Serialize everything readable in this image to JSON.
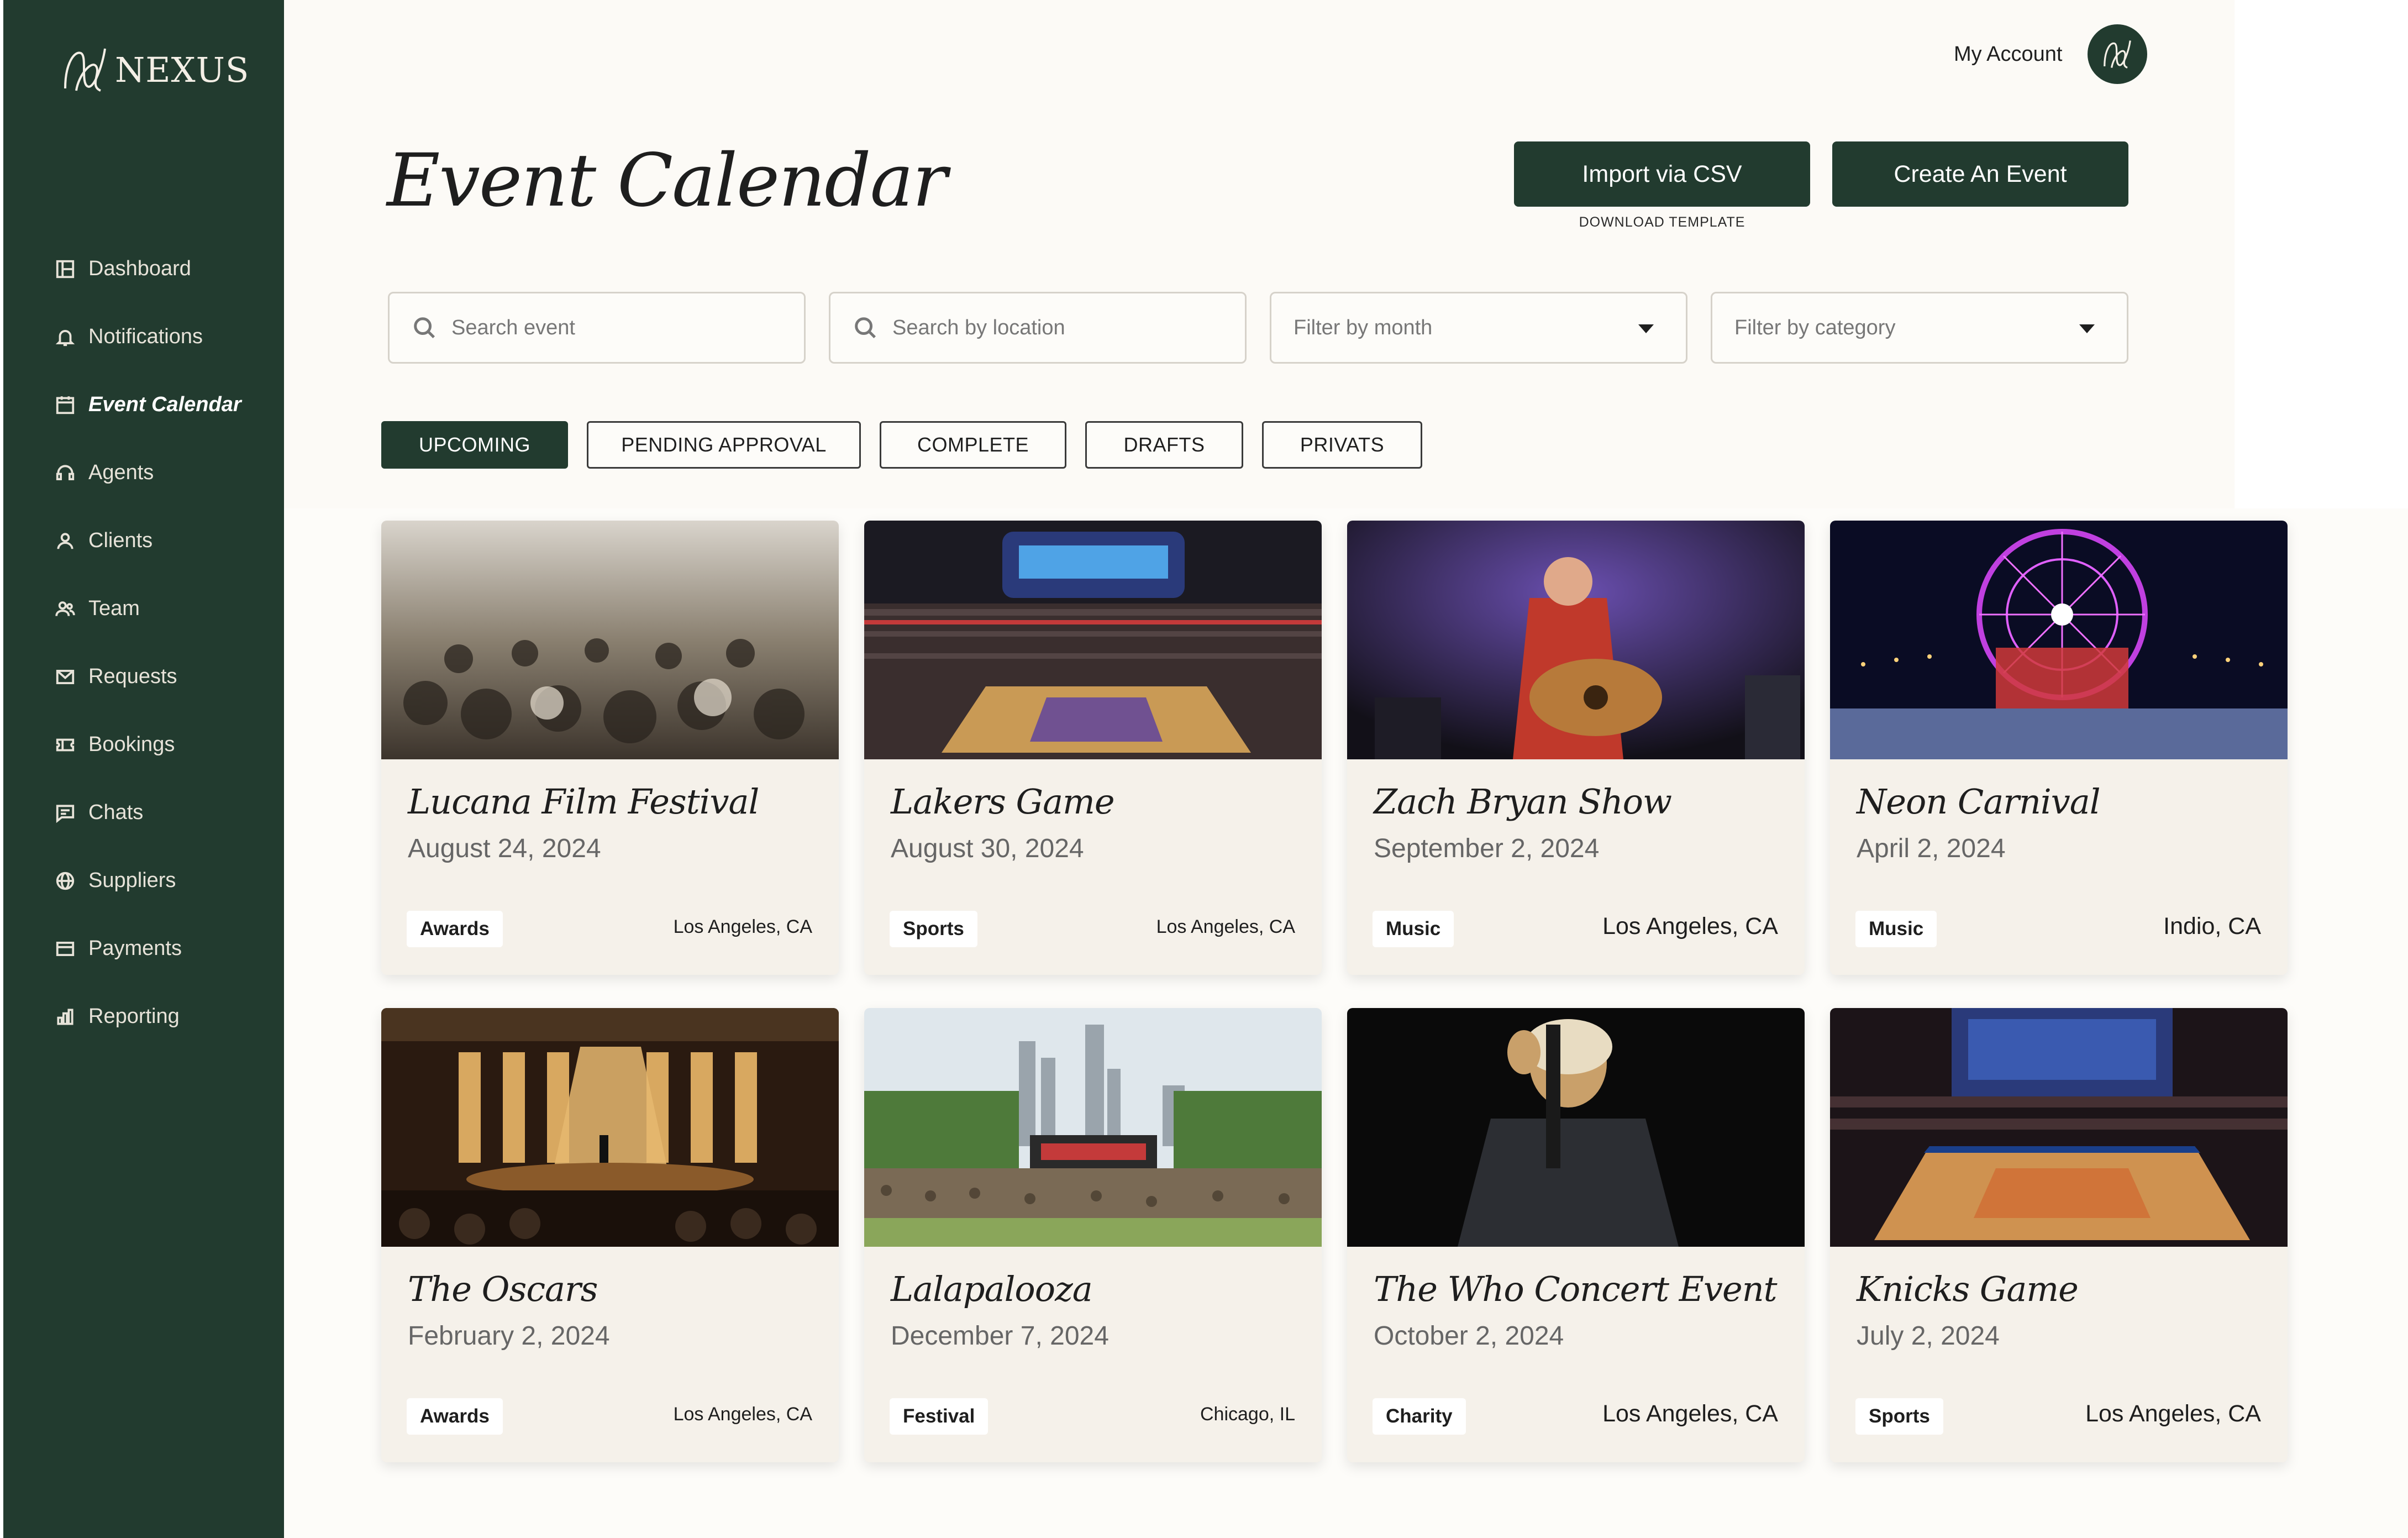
{
  "brand": {
    "name": "NEXUS"
  },
  "colors": {
    "sidebar": "#223b2f",
    "accent": "#223b2f",
    "background": "#fcfaf6",
    "card": "#f5f1ea"
  },
  "sidebar": {
    "items": [
      {
        "label": "Dashboard",
        "icon": "dashboard-icon"
      },
      {
        "label": "Notifications",
        "icon": "bell-icon"
      },
      {
        "label": "Event Calendar",
        "icon": "calendar-icon",
        "active": true
      },
      {
        "label": "Agents",
        "icon": "headset-icon"
      },
      {
        "label": "Clients",
        "icon": "user-icon"
      },
      {
        "label": "Team",
        "icon": "team-icon"
      },
      {
        "label": "Requests",
        "icon": "mail-icon"
      },
      {
        "label": "Bookings",
        "icon": "ticket-icon"
      },
      {
        "label": "Chats",
        "icon": "chat-icon"
      },
      {
        "label": "Suppliers",
        "icon": "globe-icon"
      },
      {
        "label": "Payments",
        "icon": "card-icon"
      },
      {
        "label": "Reporting",
        "icon": "bar-chart-icon"
      }
    ]
  },
  "header": {
    "account_label": "My Account",
    "title": "Event Calendar",
    "import_label": "Import via CSV",
    "create_label": "Create An Event",
    "download_template": "DOWNLOAD TEMPLATE"
  },
  "filters": {
    "search_event": "Search event",
    "search_location": "Search by location",
    "filter_month": "Filter by month",
    "filter_category": "Filter by category"
  },
  "tabs": [
    {
      "label": "UPCOMING",
      "active": true
    },
    {
      "label": "PENDING APPROVAL"
    },
    {
      "label": "COMPLETE"
    },
    {
      "label": "DRAFTS"
    },
    {
      "label": "PRIVATS"
    }
  ],
  "events": [
    {
      "title": "Lucana Film Festival",
      "date": "August 24, 2024",
      "category": "Awards",
      "location": "Los Angeles, CA",
      "image": "audience-photo"
    },
    {
      "title": "Lakers Game",
      "date": "August 30, 2024",
      "category": "Sports",
      "location": "Los Angeles, CA",
      "image": "arena-photo"
    },
    {
      "title": "Zach Bryan Show",
      "date": "September 2, 2024",
      "category": "Music",
      "location": "Los Angeles, CA",
      "image": "concert-photo"
    },
    {
      "title": "Neon Carnival",
      "date": "April 2, 2024",
      "category": "Music",
      "location": "Indio, CA",
      "image": "ferris-wheel-photo"
    },
    {
      "title": "The Oscars",
      "date": "February 2, 2024",
      "category": "Awards",
      "location": "Los Angeles, CA",
      "image": "stage-photo"
    },
    {
      "title": "Lalapalooza",
      "date": "December 7, 2024",
      "category": "Festival",
      "location": "Chicago, IL",
      "image": "festival-photo"
    },
    {
      "title": "The Who Concert Event",
      "date": "October 2, 2024",
      "category": "Charity",
      "location": "Los Angeles, CA",
      "image": "singer-photo"
    },
    {
      "title": "Knicks Game",
      "date": "July 2, 2024",
      "category": "Sports",
      "location": "Los Angeles, CA",
      "image": "arena-photo"
    }
  ]
}
